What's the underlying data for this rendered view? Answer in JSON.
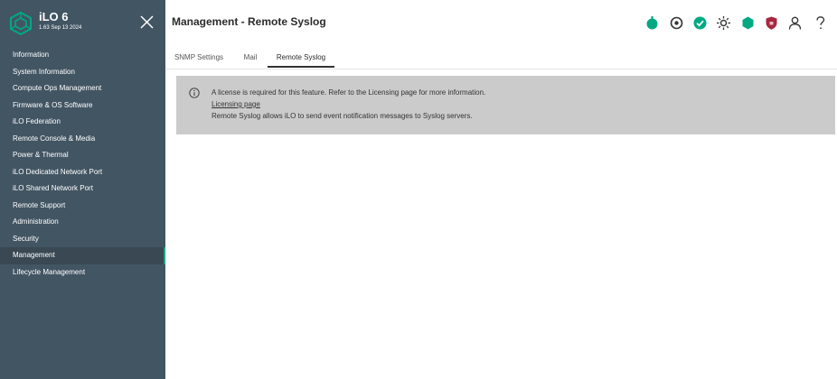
{
  "sidebar": {
    "brand_name": "iLO 6",
    "brand_version": "1.63 Sep 13 2024",
    "items": [
      {
        "label": "Information"
      },
      {
        "label": "System Information"
      },
      {
        "label": "Compute Ops Management"
      },
      {
        "label": "Firmware & OS Software"
      },
      {
        "label": "iLO Federation"
      },
      {
        "label": "Remote Console & Media"
      },
      {
        "label": "Power & Thermal"
      },
      {
        "label": "iLO Dedicated Network Port"
      },
      {
        "label": "iLO Shared Network Port"
      },
      {
        "label": "Remote Support"
      },
      {
        "label": "Administration"
      },
      {
        "label": "Security"
      },
      {
        "label": "Management"
      },
      {
        "label": "Lifecycle Management"
      }
    ],
    "active_item": "Management"
  },
  "header": {
    "title": "Management - Remote Syslog",
    "icons": [
      "power-icon",
      "target-icon",
      "health-check-icon",
      "uid-light-icon",
      "hexagon-status-icon",
      "security-shield-icon",
      "user-icon",
      "help-icon"
    ]
  },
  "tabs": [
    {
      "label": "SNMP Settings"
    },
    {
      "label": "Mail"
    },
    {
      "label": "Remote Syslog"
    }
  ],
  "active_tab": "Remote Syslog",
  "notice": {
    "icon": "info-icon",
    "message": "A license is required for this feature. Refer to the Licensing page for more information.",
    "link_label": "Licensing page",
    "description": "Remote Syslog allows iLO to send event notification messages to Syslog servers."
  },
  "colors": {
    "sidebar_bg": "#425563",
    "accent": "#01a982",
    "notice_bg": "#cbcbcb",
    "shield_red": "#a8273d"
  }
}
